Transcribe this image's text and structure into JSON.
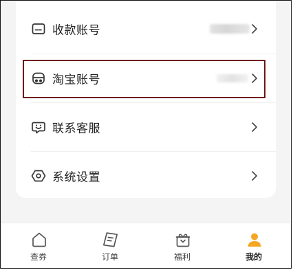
{
  "menu": {
    "items": [
      {
        "label": "收款账号",
        "icon": "payment-card-icon"
      },
      {
        "label": "淘宝账号",
        "icon": "taobao-icon"
      },
      {
        "label": "联系客服",
        "icon": "chat-support-icon"
      },
      {
        "label": "系统设置",
        "icon": "settings-hexagon-icon"
      }
    ]
  },
  "tabbar": {
    "tabs": [
      {
        "label": "查券",
        "icon": "home-icon"
      },
      {
        "label": "订单",
        "icon": "order-icon"
      },
      {
        "label": "福利",
        "icon": "gift-icon"
      },
      {
        "label": "我的",
        "icon": "profile-icon",
        "active": true
      }
    ]
  },
  "colors": {
    "accent": "#f5a623",
    "highlight_border": "#6e1414",
    "text": "#222222",
    "background": "#f4f4f4"
  }
}
